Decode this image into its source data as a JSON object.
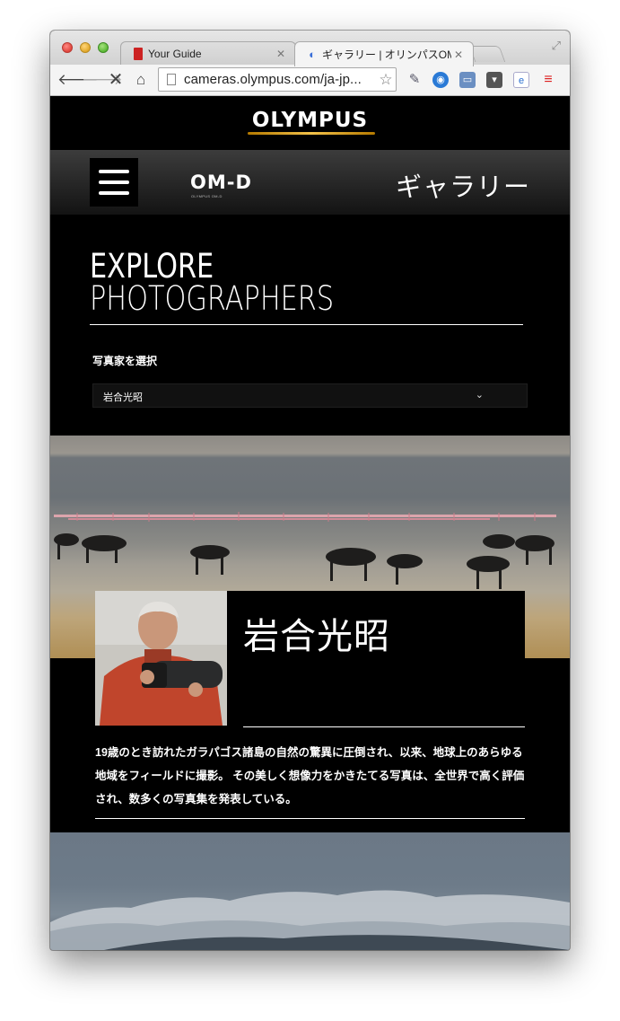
{
  "browser": {
    "tabs": [
      {
        "title": "Your Guide",
        "active": false
      },
      {
        "title": "ギャラリー | オリンパスOM",
        "active": true
      }
    ],
    "url": "cameras.olympus.com/ja-jp...",
    "icons": {
      "back": "back-arrow-icon",
      "forward": "forward-arrow-icon",
      "stop": "stop-icon",
      "home": "home-icon",
      "bookmark": "star-icon",
      "menu": "chrome-menu-icon"
    }
  },
  "header": {
    "brand": "OLYMPUS",
    "sub_brand": "OM-D",
    "sub_brand_caption": "OLYMPUS OM-D",
    "page_title": "ギャラリー"
  },
  "explore": {
    "line1": "EXPLORE",
    "line2": "PHOTOGRAPHERS",
    "select_label": "写真家を選択",
    "selected_photographer": "岩合光昭",
    "chevron": "⌄"
  },
  "photographer": {
    "name": "岩合光昭",
    "bio": "19歳のとき訪れたガラパゴス諸島の自然の驚異に圧倒され、以来、地球上のあらゆる地域をフィールドに撮影。 その美しく想像力をかきたてる写真は、全世界で高く評価され、数多くの写真集を発表している。"
  },
  "colors": {
    "page_background": "#000000",
    "text": "#ffffff",
    "brand_accent": "#f3c24a"
  }
}
